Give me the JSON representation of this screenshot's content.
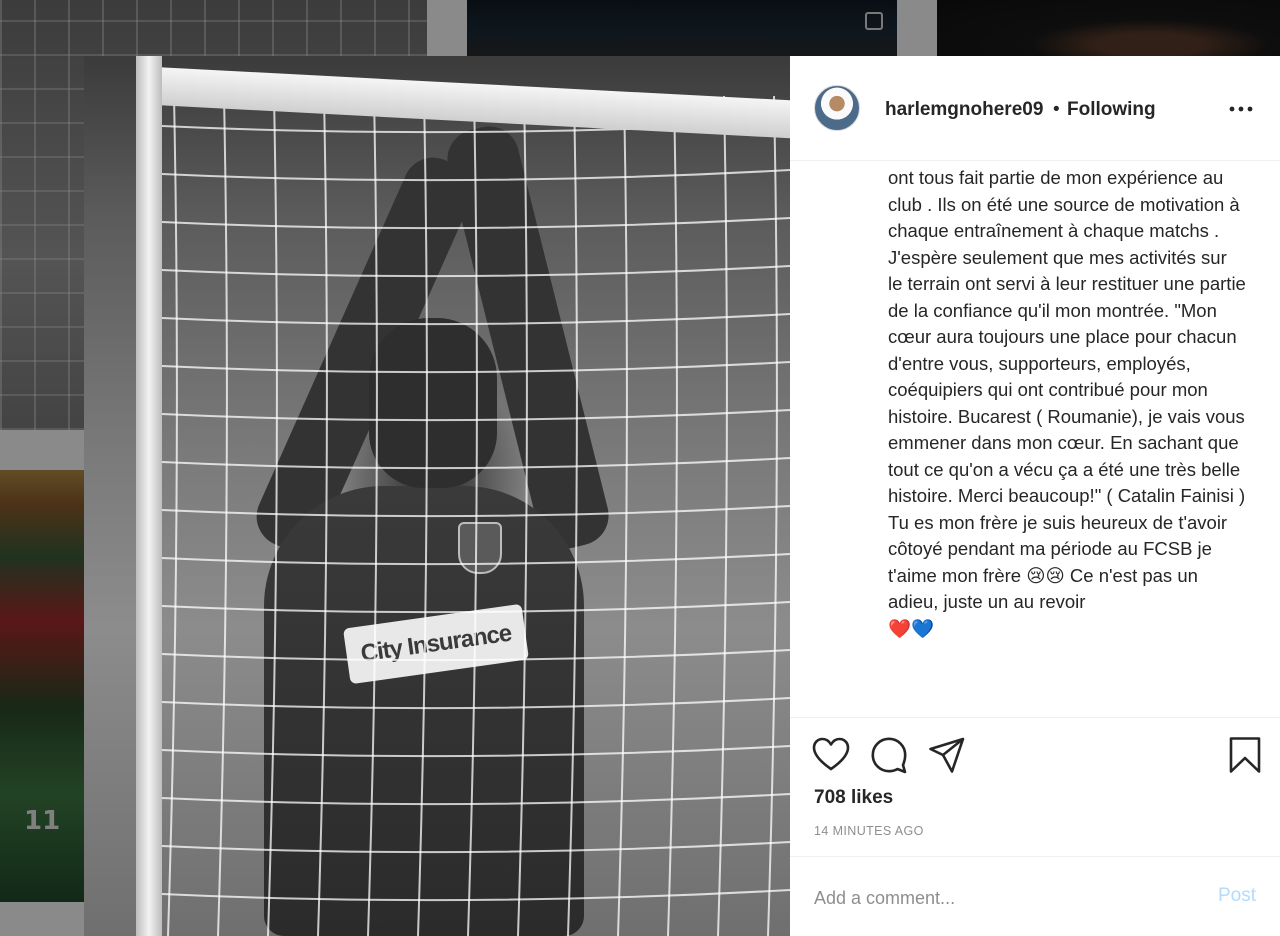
{
  "post": {
    "username": "harlemgnohere09",
    "separator": "•",
    "follow_status": "Following",
    "caption": "ont tous fait partie de mon expérience au club . Ils on été une source de motivation à chaque entraînement à chaque matchs . J'espère seulement que mes activités sur le terrain ont servi à leur restituer une partie de la confiance qu'il mon montrée. \"Mon cœur aura toujours une place pour chacun d'entre vous, supporteurs, employés, coéquipiers qui ont contribué pour mon histoire. Bucarest ( Roumanie), je vais vous emmener dans mon cœur. En sachant que tout ce qu'on a vécu ça a été une très belle histoire. Merci beaucoup!\" ( Catalin Fainisi )\nTu es mon frère je suis heureux de t'avoir côtoyé pendant ma période au FCSB je t'aime mon frère 😢😢 Ce n'est pas un adieu, juste un au revoir\n❤️💙",
    "likes": "708 likes",
    "timestamp": "14 MINUTES AGO",
    "image_sponsor_text": "City Insurance",
    "image_jersey_number": "11"
  },
  "comment": {
    "placeholder": "Add a comment...",
    "post_label": "Post"
  },
  "colors": {
    "text": "#262626",
    "muted": "#8e8e8e",
    "post_button_disabled": "#b3dbff",
    "divider": "#efefef",
    "overlay": "rgba(0,0,0,0.45)"
  },
  "icons": [
    "more-options-icon",
    "heart-icon",
    "comment-icon",
    "share-icon",
    "bookmark-icon",
    "gallery-icon"
  ]
}
